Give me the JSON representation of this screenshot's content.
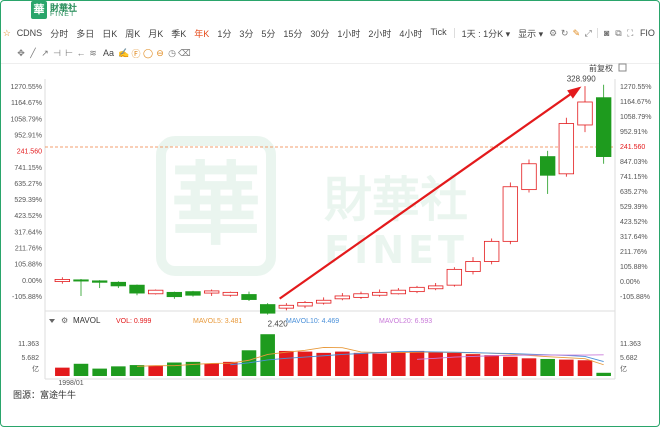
{
  "brand": {
    "cn": "財華社",
    "en": "FINET",
    "mark": "華"
  },
  "toolbar_top": {
    "ticker": "CDNS",
    "periods": [
      "分时",
      "多日",
      "日K",
      "周K",
      "月K",
      "季K",
      "年K",
      "1分",
      "3分",
      "5分",
      "15分",
      "30分",
      "1小时",
      "2小时",
      "4小时",
      "Tick"
    ],
    "active_period": "年K",
    "range_select": "1天 : 1分K ▾",
    "display_label": "显示 ▾",
    "fio_label": "FIO"
  },
  "toolbar_draw": {
    "font_label": "Aa",
    "icons": [
      "move-icon",
      "line-icon",
      "ray-icon",
      "hline-icon",
      "vline-icon",
      "arrow-icon",
      "channel-icon",
      "text-icon",
      "brush-icon",
      "fib-icon",
      "circle-icon",
      "ellipse-icon",
      "clock-icon",
      "eraser-icon"
    ]
  },
  "price_panel": {
    "adjust_label": "前复权",
    "left_ticks": [
      "1270.55%",
      "1164.67%",
      "1058.79%",
      "952.91%",
      "241.560",
      "741.15%",
      "635.27%",
      "529.39%",
      "423.52%",
      "317.64%",
      "211.76%",
      "105.88%",
      "0.00%",
      "-105.88%"
    ],
    "right_ticks": [
      "1270.55%",
      "1164.67%",
      "1058.79%",
      "952.91%",
      "241.560",
      "847.03%",
      "741.15%",
      "635.27%",
      "529.39%",
      "423.52%",
      "317.64%",
      "211.76%",
      "105.88%",
      "0.00%",
      "-105.88%"
    ],
    "high_label": "328.990",
    "low_label": "2.420",
    "last_price_label": "241.560"
  },
  "volume_panel": {
    "indicator": "MAVOL",
    "vol_label": "VOL: 0.999",
    "mavol5_label": "MAVOL5: 3.481",
    "mavol10_label": "MAVOL10: 4.469",
    "mavol20_label": "MAVOL20: 6.593",
    "y_ticks": [
      "11.363",
      "5.682",
      "亿"
    ],
    "right_ticks": [
      "11.363",
      "5.682",
      "亿"
    ],
    "x_label": "1998/01"
  },
  "colors": {
    "up": "#e31a1c",
    "down": "#1e9b1e",
    "accent": "#e64a19",
    "mavol5": "#e89a3c",
    "mavol10": "#4a90d9",
    "mavol20": "#c97ad9",
    "last_price_line": "#f08040",
    "frame": "#2aa56b",
    "watermark": "#8fc9a9"
  },
  "chart_data": {
    "type": "candlestick",
    "series_name": "CDNS",
    "period": "yearly",
    "first_period": "1998/01",
    "unit": "% change (front-adjusted)",
    "candles": [
      {
        "open": 10,
        "close": 25,
        "high": 40,
        "low": -5
      },
      {
        "open": 22,
        "close": 15,
        "high": 28,
        "low": -90
      },
      {
        "open": 15,
        "close": 5,
        "high": 20,
        "low": -35
      },
      {
        "open": 5,
        "close": -20,
        "high": 12,
        "low": -35
      },
      {
        "open": -15,
        "close": -70,
        "high": -10,
        "low": -85
      },
      {
        "open": -75,
        "close": -50,
        "high": -45,
        "low": -80
      },
      {
        "open": -65,
        "close": -95,
        "high": -60,
        "low": -110
      },
      {
        "open": -60,
        "close": -85,
        "high": -55,
        "low": -95
      },
      {
        "open": -70,
        "close": -55,
        "high": -45,
        "low": -90
      },
      {
        "open": -85,
        "close": -65,
        "high": -60,
        "low": -95
      },
      {
        "open": -80,
        "close": -115,
        "high": -60,
        "low": -125
      },
      {
        "open": -150,
        "close": -210,
        "high": -140,
        "low": -220
      },
      {
        "open": -175,
        "close": -155,
        "high": -140,
        "low": -190
      },
      {
        "open": -160,
        "close": -135,
        "high": -125,
        "low": -175
      },
      {
        "open": -140,
        "close": -120,
        "high": -100,
        "low": -150
      },
      {
        "open": -110,
        "close": -90,
        "high": -70,
        "low": -120
      },
      {
        "open": -100,
        "close": -75,
        "high": -60,
        "low": -110
      },
      {
        "open": -85,
        "close": -65,
        "high": -45,
        "low": -95
      },
      {
        "open": -75,
        "close": -50,
        "high": -35,
        "low": -80
      },
      {
        "open": -60,
        "close": -30,
        "high": -20,
        "low": -70
      },
      {
        "open": -40,
        "close": -20,
        "high": 0,
        "low": -50
      },
      {
        "open": -15,
        "close": 95,
        "high": 110,
        "low": -25
      },
      {
        "open": 80,
        "close": 150,
        "high": 180,
        "low": 60
      },
      {
        "open": 150,
        "close": 290,
        "high": 310,
        "low": 130
      },
      {
        "open": 290,
        "close": 670,
        "high": 700,
        "low": 270
      },
      {
        "open": 650,
        "close": 830,
        "high": 860,
        "low": 630
      },
      {
        "open": 880,
        "close": 750,
        "high": 920,
        "low": 620
      },
      {
        "open": 760,
        "close": 1110,
        "high": 1150,
        "low": 740
      },
      {
        "open": 1100,
        "close": 1260,
        "high": 1370,
        "low": 1050
      },
      {
        "open": 1290,
        "close": 880,
        "high": 1380,
        "low": 830
      }
    ],
    "volume": [
      2.6,
      3.8,
      2.3,
      3.0,
      3.4,
      3.3,
      4.2,
      4.4,
      3.9,
      4.4,
      8.0,
      13.0,
      7.8,
      7.6,
      7.2,
      7.6,
      7.2,
      7.0,
      7.5,
      7.8,
      7.4,
      7.2,
      6.8,
      6.5,
      6.0,
      5.5,
      5.3,
      5.1,
      4.9,
      0.999
    ],
    "mavol5": [
      null,
      null,
      null,
      null,
      3.0,
      3.2,
      3.2,
      3.6,
      3.9,
      4.0,
      4.9,
      6.7,
      7.4,
      8.0,
      8.9,
      8.8,
      7.5,
      7.3,
      7.3,
      7.4,
      7.4,
      7.3,
      7.2,
      7.1,
      6.8,
      6.4,
      6.0,
      5.7,
      5.4,
      3.5
    ],
    "mavol10": [
      null,
      null,
      null,
      null,
      null,
      null,
      null,
      null,
      null,
      3.5,
      4.1,
      5.0,
      5.5,
      5.9,
      6.3,
      6.7,
      7.0,
      7.3,
      7.6,
      7.6,
      7.5,
      7.4,
      7.3,
      7.1,
      7.0,
      6.8,
      6.6,
      6.4,
      6.1,
      4.5
    ],
    "mavol20": [
      null,
      null,
      null,
      null,
      null,
      null,
      null,
      null,
      null,
      null,
      null,
      null,
      null,
      null,
      null,
      null,
      null,
      null,
      null,
      5.2,
      5.5,
      5.9,
      6.1,
      6.3,
      6.4,
      6.5,
      6.5,
      6.5,
      6.5,
      6.6
    ],
    "y_range_pct": [
      -160,
      1420
    ],
    "volume_range_yi": [
      0,
      14
    ]
  },
  "source_text": "图源：富途牛牛"
}
